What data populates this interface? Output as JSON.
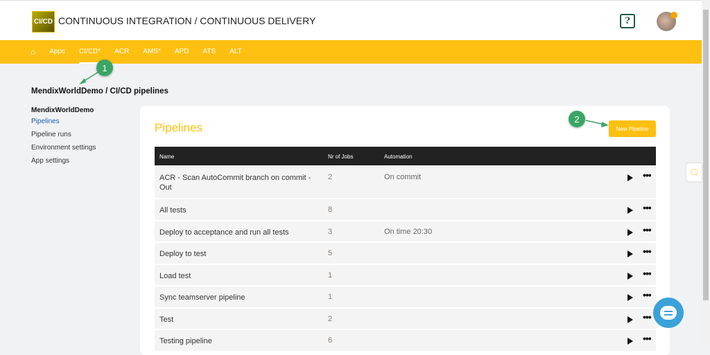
{
  "header": {
    "logo_text": "CI/CD",
    "title": "CONTINUOUS INTEGRATION / CONTINUOUS DELIVERY",
    "help_label": "?"
  },
  "nav": {
    "items": [
      {
        "label": "Apps"
      },
      {
        "label": "CI/CD*"
      },
      {
        "label": "ACR"
      },
      {
        "label": "AMS*"
      },
      {
        "label": "APD"
      },
      {
        "label": "ATS"
      },
      {
        "label": "ALT"
      }
    ]
  },
  "breadcrumb": "MendixWorldDemo / CI/CD pipelines",
  "sidebar": {
    "title": "MendixWorldDemo",
    "items": [
      "Pipelines",
      "Pipeline runs",
      "Environment settings",
      "App settings"
    ]
  },
  "main": {
    "title": "Pipelines",
    "new_button": "New Pipeline",
    "columns": [
      "Name",
      "Nr of Jobs",
      "Automation"
    ],
    "rows": [
      {
        "name": "ACR - Scan AutoCommit branch on commit - Out",
        "jobs": "2",
        "automation": "On commit"
      },
      {
        "name": "All tests",
        "jobs": "8",
        "automation": ""
      },
      {
        "name": "Deploy to acceptance and run all tests",
        "jobs": "3",
        "automation": "On time 20:30"
      },
      {
        "name": "Deploy to test",
        "jobs": "5",
        "automation": ""
      },
      {
        "name": "Load test",
        "jobs": "1",
        "automation": ""
      },
      {
        "name": "Sync teamserver pipeline",
        "jobs": "1",
        "automation": ""
      },
      {
        "name": "Test",
        "jobs": "2",
        "automation": ""
      },
      {
        "name": "Testing pipeline",
        "jobs": "6",
        "automation": ""
      }
    ]
  },
  "annotations": [
    "1",
    "2"
  ],
  "colors": {
    "accent": "#fdc010",
    "annotation": "#3aa565",
    "header_row": "#222222"
  }
}
